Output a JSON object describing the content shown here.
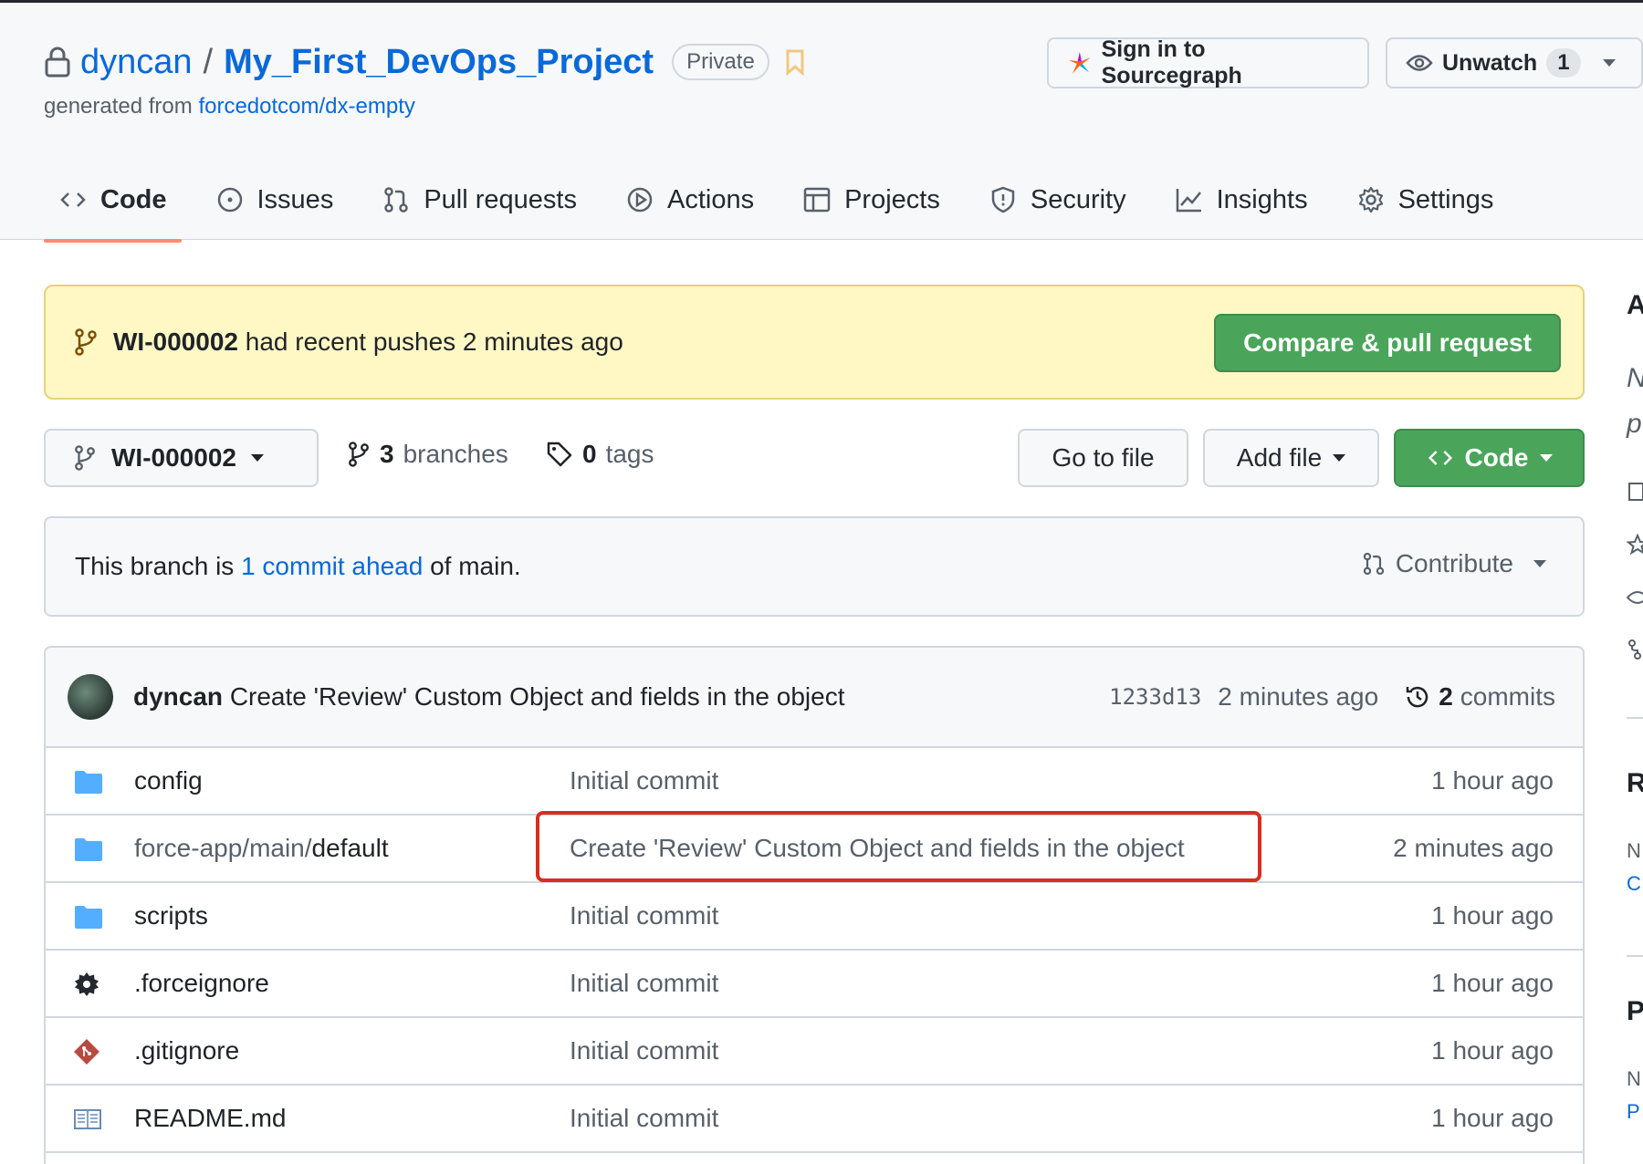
{
  "repo": {
    "owner": "dyncan",
    "separator": "/",
    "name": "My_First_DevOps_Project",
    "visibility": "Private",
    "generated_prefix": "generated from",
    "generated_from": "forcedotcom/dx-empty"
  },
  "header_buttons": {
    "sourcegraph": "Sign in to Sourcegraph",
    "unwatch": "Unwatch",
    "watch_count": "1"
  },
  "tabs": [
    {
      "label": "Code",
      "icon": "code-icon",
      "active": true
    },
    {
      "label": "Issues",
      "icon": "issue-icon"
    },
    {
      "label": "Pull requests",
      "icon": "pull-request-icon"
    },
    {
      "label": "Actions",
      "icon": "play-icon"
    },
    {
      "label": "Projects",
      "icon": "table-icon"
    },
    {
      "label": "Security",
      "icon": "shield-icon"
    },
    {
      "label": "Insights",
      "icon": "graph-icon"
    },
    {
      "label": "Settings",
      "icon": "gear-icon"
    }
  ],
  "banner": {
    "branch": "WI-000002",
    "text": "had recent pushes 2 minutes ago",
    "button": "Compare & pull request"
  },
  "toolbar": {
    "branch": "WI-000002",
    "branches_count": "3",
    "branches_label": "branches",
    "tags_count": "0",
    "tags_label": "tags",
    "goto_file": "Go to file",
    "add_file": "Add file",
    "code": "Code"
  },
  "ahead": {
    "prefix": "This branch is",
    "link": "1 commit ahead",
    "suffix": "of main.",
    "contribute": "Contribute"
  },
  "latest_commit": {
    "author": "dyncan",
    "message": "Create 'Review' Custom Object and fields in the object",
    "sha": "1233d13",
    "age": "2 minutes ago",
    "commits_count": "2",
    "commits_label": "commits"
  },
  "files": [
    {
      "icon": "folder-icon",
      "name_dim": "",
      "name": "config",
      "message": "Initial commit",
      "age": "1 hour ago"
    },
    {
      "icon": "folder-icon",
      "name_dim": "force-app/main/",
      "name": "default",
      "message": "Create 'Review' Custom Object and fields in the object",
      "age": "2 minutes ago"
    },
    {
      "icon": "folder-icon",
      "name_dim": "",
      "name": "scripts",
      "message": "Initial commit",
      "age": "1 hour ago"
    },
    {
      "icon": "gear-file-icon",
      "name_dim": "",
      "name": ".forceignore",
      "message": "Initial commit",
      "age": "1 hour ago"
    },
    {
      "icon": "git-file-icon",
      "name_dim": "",
      "name": ".gitignore",
      "message": "Initial commit",
      "age": "1 hour ago"
    },
    {
      "icon": "book-icon",
      "name_dim": "",
      "name": "README.md",
      "message": "Initial commit",
      "age": "1 hour ago"
    }
  ],
  "sidebar": {
    "about_letter": "A",
    "desc_line1": "N",
    "desc_line2": "p",
    "releases_letter": "R",
    "releases_text": "N",
    "releases_link": "C",
    "packages_letter": "P",
    "packages_text": "N",
    "packages_link": "P"
  },
  "colors": {
    "accent": "#0969da",
    "green": "#4aa55a",
    "highlight": "#d92d20",
    "tab_underline": "#fd8c73"
  }
}
